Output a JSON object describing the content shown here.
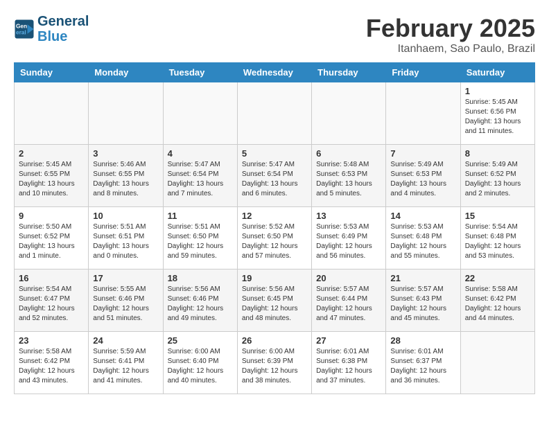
{
  "header": {
    "logo_line1": "General",
    "logo_line2": "Blue",
    "month_title": "February 2025",
    "location": "Itanhaem, Sao Paulo, Brazil"
  },
  "weekdays": [
    "Sunday",
    "Monday",
    "Tuesday",
    "Wednesday",
    "Thursday",
    "Friday",
    "Saturday"
  ],
  "weeks": [
    [
      {
        "day": "",
        "info": ""
      },
      {
        "day": "",
        "info": ""
      },
      {
        "day": "",
        "info": ""
      },
      {
        "day": "",
        "info": ""
      },
      {
        "day": "",
        "info": ""
      },
      {
        "day": "",
        "info": ""
      },
      {
        "day": "1",
        "info": "Sunrise: 5:45 AM\nSunset: 6:56 PM\nDaylight: 13 hours\nand 11 minutes."
      }
    ],
    [
      {
        "day": "2",
        "info": "Sunrise: 5:45 AM\nSunset: 6:55 PM\nDaylight: 13 hours\nand 10 minutes."
      },
      {
        "day": "3",
        "info": "Sunrise: 5:46 AM\nSunset: 6:55 PM\nDaylight: 13 hours\nand 8 minutes."
      },
      {
        "day": "4",
        "info": "Sunrise: 5:47 AM\nSunset: 6:54 PM\nDaylight: 13 hours\nand 7 minutes."
      },
      {
        "day": "5",
        "info": "Sunrise: 5:47 AM\nSunset: 6:54 PM\nDaylight: 13 hours\nand 6 minutes."
      },
      {
        "day": "6",
        "info": "Sunrise: 5:48 AM\nSunset: 6:53 PM\nDaylight: 13 hours\nand 5 minutes."
      },
      {
        "day": "7",
        "info": "Sunrise: 5:49 AM\nSunset: 6:53 PM\nDaylight: 13 hours\nand 4 minutes."
      },
      {
        "day": "8",
        "info": "Sunrise: 5:49 AM\nSunset: 6:52 PM\nDaylight: 13 hours\nand 2 minutes."
      }
    ],
    [
      {
        "day": "9",
        "info": "Sunrise: 5:50 AM\nSunset: 6:52 PM\nDaylight: 13 hours\nand 1 minute."
      },
      {
        "day": "10",
        "info": "Sunrise: 5:51 AM\nSunset: 6:51 PM\nDaylight: 13 hours\nand 0 minutes."
      },
      {
        "day": "11",
        "info": "Sunrise: 5:51 AM\nSunset: 6:50 PM\nDaylight: 12 hours\nand 59 minutes."
      },
      {
        "day": "12",
        "info": "Sunrise: 5:52 AM\nSunset: 6:50 PM\nDaylight: 12 hours\nand 57 minutes."
      },
      {
        "day": "13",
        "info": "Sunrise: 5:53 AM\nSunset: 6:49 PM\nDaylight: 12 hours\nand 56 minutes."
      },
      {
        "day": "14",
        "info": "Sunrise: 5:53 AM\nSunset: 6:48 PM\nDaylight: 12 hours\nand 55 minutes."
      },
      {
        "day": "15",
        "info": "Sunrise: 5:54 AM\nSunset: 6:48 PM\nDaylight: 12 hours\nand 53 minutes."
      }
    ],
    [
      {
        "day": "16",
        "info": "Sunrise: 5:54 AM\nSunset: 6:47 PM\nDaylight: 12 hours\nand 52 minutes."
      },
      {
        "day": "17",
        "info": "Sunrise: 5:55 AM\nSunset: 6:46 PM\nDaylight: 12 hours\nand 51 minutes."
      },
      {
        "day": "18",
        "info": "Sunrise: 5:56 AM\nSunset: 6:46 PM\nDaylight: 12 hours\nand 49 minutes."
      },
      {
        "day": "19",
        "info": "Sunrise: 5:56 AM\nSunset: 6:45 PM\nDaylight: 12 hours\nand 48 minutes."
      },
      {
        "day": "20",
        "info": "Sunrise: 5:57 AM\nSunset: 6:44 PM\nDaylight: 12 hours\nand 47 minutes."
      },
      {
        "day": "21",
        "info": "Sunrise: 5:57 AM\nSunset: 6:43 PM\nDaylight: 12 hours\nand 45 minutes."
      },
      {
        "day": "22",
        "info": "Sunrise: 5:58 AM\nSunset: 6:42 PM\nDaylight: 12 hours\nand 44 minutes."
      }
    ],
    [
      {
        "day": "23",
        "info": "Sunrise: 5:58 AM\nSunset: 6:42 PM\nDaylight: 12 hours\nand 43 minutes."
      },
      {
        "day": "24",
        "info": "Sunrise: 5:59 AM\nSunset: 6:41 PM\nDaylight: 12 hours\nand 41 minutes."
      },
      {
        "day": "25",
        "info": "Sunrise: 6:00 AM\nSunset: 6:40 PM\nDaylight: 12 hours\nand 40 minutes."
      },
      {
        "day": "26",
        "info": "Sunrise: 6:00 AM\nSunset: 6:39 PM\nDaylight: 12 hours\nand 38 minutes."
      },
      {
        "day": "27",
        "info": "Sunrise: 6:01 AM\nSunset: 6:38 PM\nDaylight: 12 hours\nand 37 minutes."
      },
      {
        "day": "28",
        "info": "Sunrise: 6:01 AM\nSunset: 6:37 PM\nDaylight: 12 hours\nand 36 minutes."
      },
      {
        "day": "",
        "info": ""
      }
    ]
  ]
}
